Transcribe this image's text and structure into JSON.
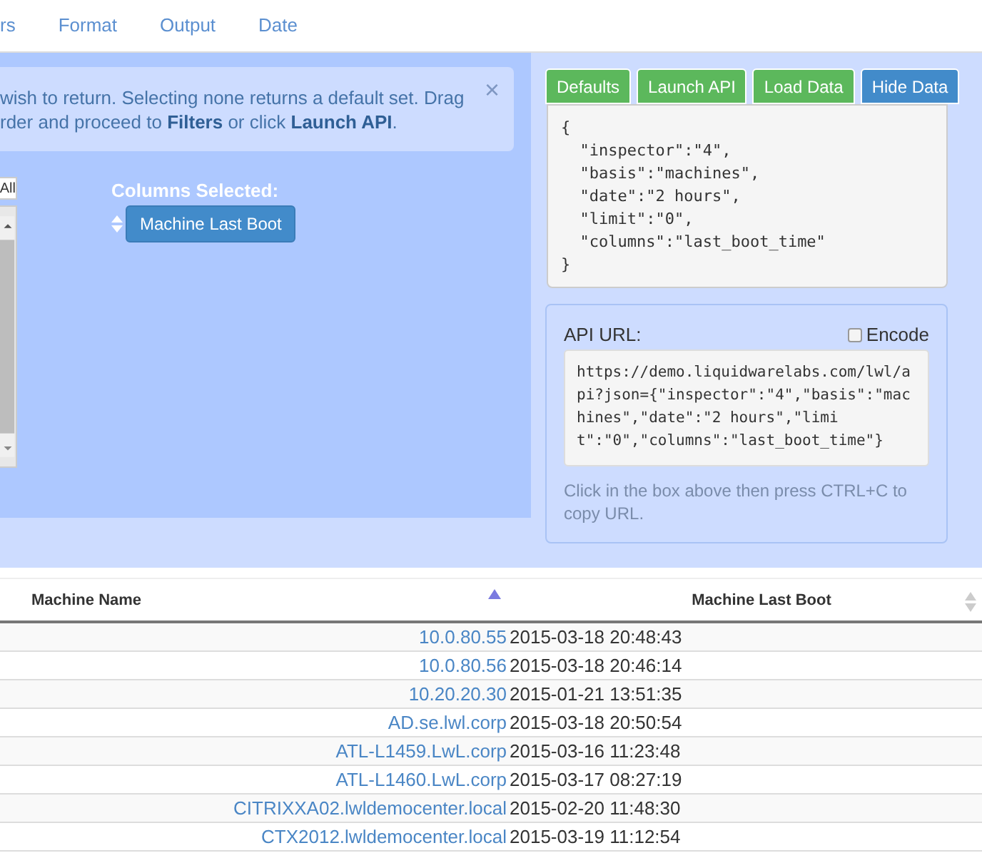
{
  "nav": {
    "tabs": [
      "rs",
      "Format",
      "Output",
      "Date"
    ]
  },
  "columns_panel": {
    "alert": {
      "text": "wish to return. Selecting none returns a default set. Drag\nrder and proceed to **Filters** or click **Launch API**.",
      "close": "×"
    },
    "select_all": "All",
    "selected_label": "Columns Selected:",
    "selected_columns": [
      "Machine Last Boot"
    ]
  },
  "api_panel": {
    "buttons": [
      {
        "label": "Defaults",
        "kind": "success"
      },
      {
        "label": "Launch API",
        "kind": "success"
      },
      {
        "label": "Load Data",
        "kind": "success"
      },
      {
        "label": "Hide Data",
        "kind": "primary"
      }
    ],
    "json_text": "{\n  \"inspector\":\"4\",\n  \"basis\":\"machines\",\n  \"date\":\"2 hours\",\n  \"limit\":\"0\",\n  \"columns\":\"last_boot_time\"\n}",
    "url_label": "API URL:",
    "encode": {
      "label": "Encode",
      "checked": false
    },
    "url": "https://demo.liquidwarelabs.com/lwl/api?json={\"inspector\":\"4\",\"basis\":\"machines\",\"date\":\"2 hours\",\"limit\":\"0\",\"columns\":\"last_boot_time\"}",
    "help": "Click in the box above then press CTRL+C to copy URL."
  },
  "table": {
    "columns": [
      {
        "label": "Machine Name",
        "sorted": true
      },
      {
        "label": "Machine Last Boot",
        "sorted": false
      }
    ],
    "rows": [
      {
        "name": "10.0.80.55",
        "last_boot": "2015-03-18 20:48:43"
      },
      {
        "name": "10.0.80.56",
        "last_boot": "2015-03-18 20:46:14"
      },
      {
        "name": "10.20.20.30",
        "last_boot": "2015-01-21 13:51:35"
      },
      {
        "name": "AD.se.lwl.corp",
        "last_boot": "2015-03-18 20:50:54"
      },
      {
        "name": "ATL-L1459.LwL.corp",
        "last_boot": "2015-03-16 11:23:48"
      },
      {
        "name": "ATL-L1460.LwL.corp",
        "last_boot": "2015-03-17 08:27:19"
      },
      {
        "name": "CITRIXXA02.lwldemocenter.local",
        "last_boot": "2015-02-20 11:48:30"
      },
      {
        "name": "CTX2012.lwldemocenter.local",
        "last_boot": "2015-03-19 11:12:54"
      }
    ]
  }
}
